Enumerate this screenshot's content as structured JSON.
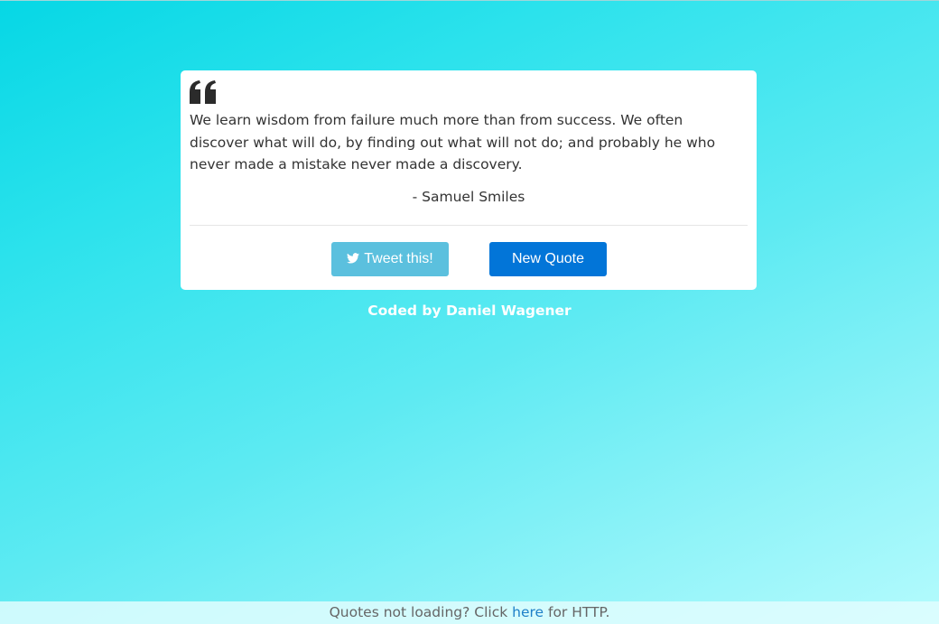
{
  "quote": {
    "text": "We learn wisdom from failure much more than from success. We often discover what will do, by finding out what will not do; and probably he who never made a mistake never made a discovery.",
    "author": "- Samuel Smiles",
    "icon": "quote-left-icon"
  },
  "buttons": {
    "tweet_label": "Tweet this!",
    "tweet_icon": "twitter-icon",
    "new_quote_label": "New Quote"
  },
  "credit": "Coded by Daniel Wagener",
  "footer": {
    "prefix": "Quotes not loading? Click ",
    "link_text": "here",
    "suffix": " for HTTP."
  },
  "colors": {
    "tweet_button": "#5bc0de",
    "new_quote_button": "#0275d8",
    "link": "#1e80c8"
  }
}
